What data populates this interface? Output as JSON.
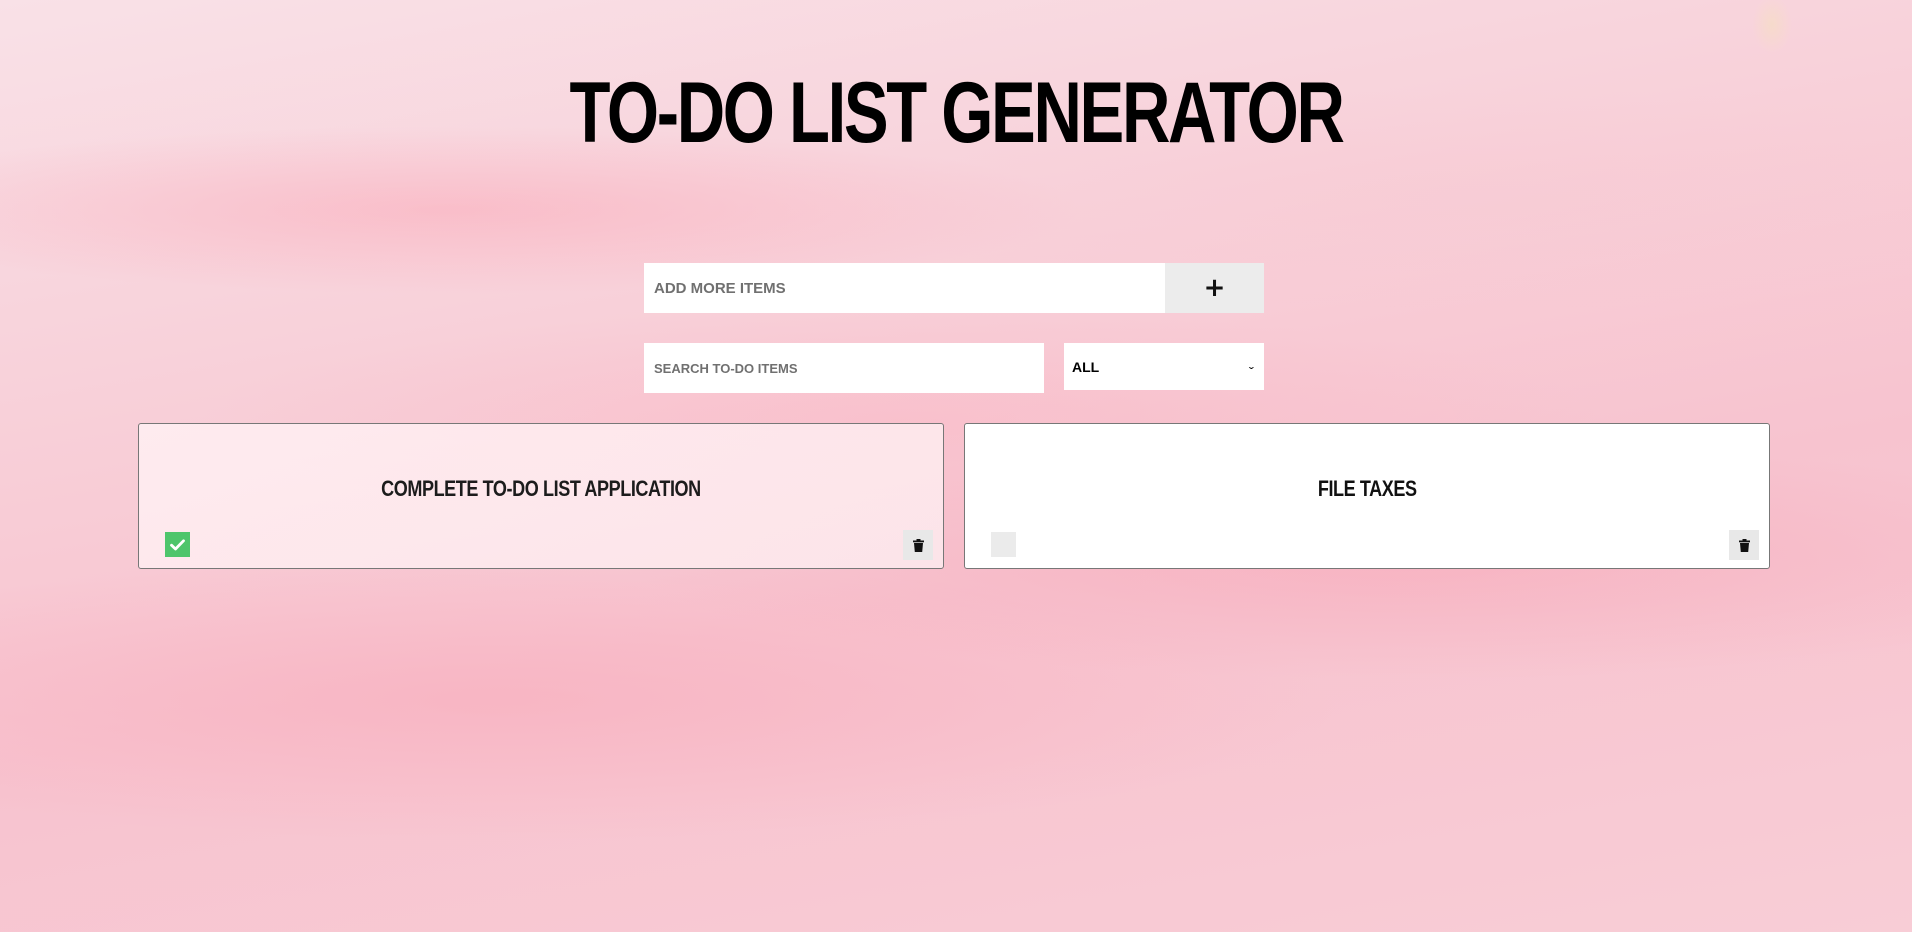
{
  "page": {
    "title": "TO-DO LIST GENERATOR"
  },
  "add_form": {
    "placeholder": "ADD MORE ITEMS",
    "button_label": "+"
  },
  "search": {
    "placeholder": "SEARCH TO-DO ITEMS"
  },
  "filter": {
    "selected": "ALL"
  },
  "todos": [
    {
      "text": "COMPLETE TO-DO LIST APPLICATION",
      "completed": true
    },
    {
      "text": "FILE TAXES",
      "completed": false
    }
  ],
  "colors": {
    "check_green": "#4ec56b",
    "title": "#000000"
  },
  "icons": {
    "complete": "check-icon",
    "delete": "trash-icon",
    "filter_dropdown": "chevron-down-icon"
  }
}
